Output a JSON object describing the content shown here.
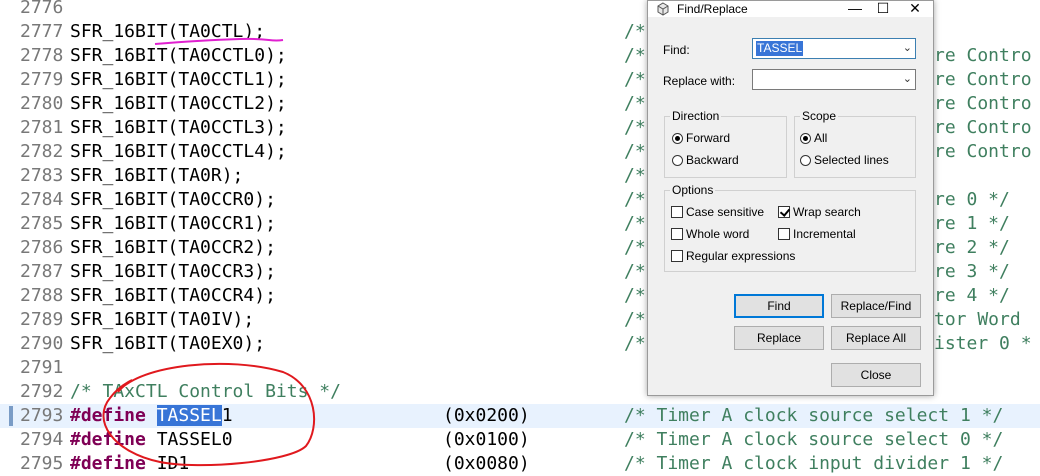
{
  "editor": {
    "lines": [
      {
        "num": "2776",
        "code": "",
        "comment": ""
      },
      {
        "num": "2777",
        "code": "SFR_16BIT(TA0CTL);",
        "comment": "/*"
      },
      {
        "num": "2778",
        "code": "SFR_16BIT(TA0CCTL0);",
        "comment": "/*",
        "tail": "re Contro"
      },
      {
        "num": "2779",
        "code": "SFR_16BIT(TA0CCTL1);",
        "comment": "/*",
        "tail": "re Contro"
      },
      {
        "num": "2780",
        "code": "SFR_16BIT(TA0CCTL2);",
        "comment": "/*",
        "tail": "re Contro"
      },
      {
        "num": "2781",
        "code": "SFR_16BIT(TA0CCTL3);",
        "comment": "/*",
        "tail": "re Contro"
      },
      {
        "num": "2782",
        "code": "SFR_16BIT(TA0CCTL4);",
        "comment": "/*",
        "tail": "re Contro"
      },
      {
        "num": "2783",
        "code": "SFR_16BIT(TA0R);",
        "comment": "/*"
      },
      {
        "num": "2784",
        "code": "SFR_16BIT(TA0CCR0);",
        "comment": "/*",
        "tail": "re 0 */"
      },
      {
        "num": "2785",
        "code": "SFR_16BIT(TA0CCR1);",
        "comment": "/*",
        "tail": "re 1 */"
      },
      {
        "num": "2786",
        "code": "SFR_16BIT(TA0CCR2);",
        "comment": "/*",
        "tail": "re 2 */"
      },
      {
        "num": "2787",
        "code": "SFR_16BIT(TA0CCR3);",
        "comment": "/*",
        "tail": "re 3 */"
      },
      {
        "num": "2788",
        "code": "SFR_16BIT(TA0CCR4);",
        "comment": "/*",
        "tail": "re 4 */"
      },
      {
        "num": "2789",
        "code": "SFR_16BIT(TA0IV);",
        "comment": "/*",
        "tail": "tor Word"
      },
      {
        "num": "2790",
        "code": "SFR_16BIT(TA0EX0);",
        "comment": "/*",
        "tail": "ister 0 *"
      },
      {
        "num": "2791",
        "code": "",
        "comment": ""
      },
      {
        "num": "2792",
        "code": "/* TAxCTL Control Bits */",
        "comment": ""
      },
      {
        "num": "2793",
        "keyword": "#define",
        "name_sel": "TASSEL",
        "name_rest": "1",
        "value": "(0x0200)",
        "comment": "/* Timer A clock source select 1 */"
      },
      {
        "num": "2794",
        "keyword": "#define",
        "name": "TASSEL0",
        "value": "(0x0100)",
        "comment": "/* Timer A clock source select 0 */"
      },
      {
        "num": "2795",
        "keyword": "#define",
        "name": "ID1",
        "value": "(0x0080)",
        "comment": "/* Timer A clock input divider 1 */"
      }
    ]
  },
  "dialog": {
    "title": "Find/Replace",
    "find_label": "Find:",
    "find_value": "TASSEL",
    "replace_label": "Replace with:",
    "replace_value": "",
    "direction": {
      "title": "Direction",
      "forward": "Forward",
      "backward": "Backward",
      "selected": "forward"
    },
    "scope": {
      "title": "Scope",
      "all": "All",
      "selected_lines": "Selected lines",
      "selected": "all"
    },
    "options": {
      "title": "Options",
      "case_sensitive": {
        "label": "Case sensitive",
        "checked": false
      },
      "wrap_search": {
        "label": "Wrap search",
        "checked": true
      },
      "whole_word": {
        "label": "Whole word",
        "checked": false
      },
      "incremental": {
        "label": "Incremental",
        "checked": false
      },
      "regex": {
        "label": "Regular expressions",
        "checked": false
      }
    },
    "buttons": {
      "find": "Find",
      "replace_find": "Replace/Find",
      "replace": "Replace",
      "replace_all": "Replace All",
      "close": "Close"
    }
  },
  "colors": {
    "comment": "#3f7f5f",
    "keyword": "#7f0055",
    "selection": "#3875d7",
    "annotation": "#e0191e",
    "underline": "#e020d0"
  }
}
